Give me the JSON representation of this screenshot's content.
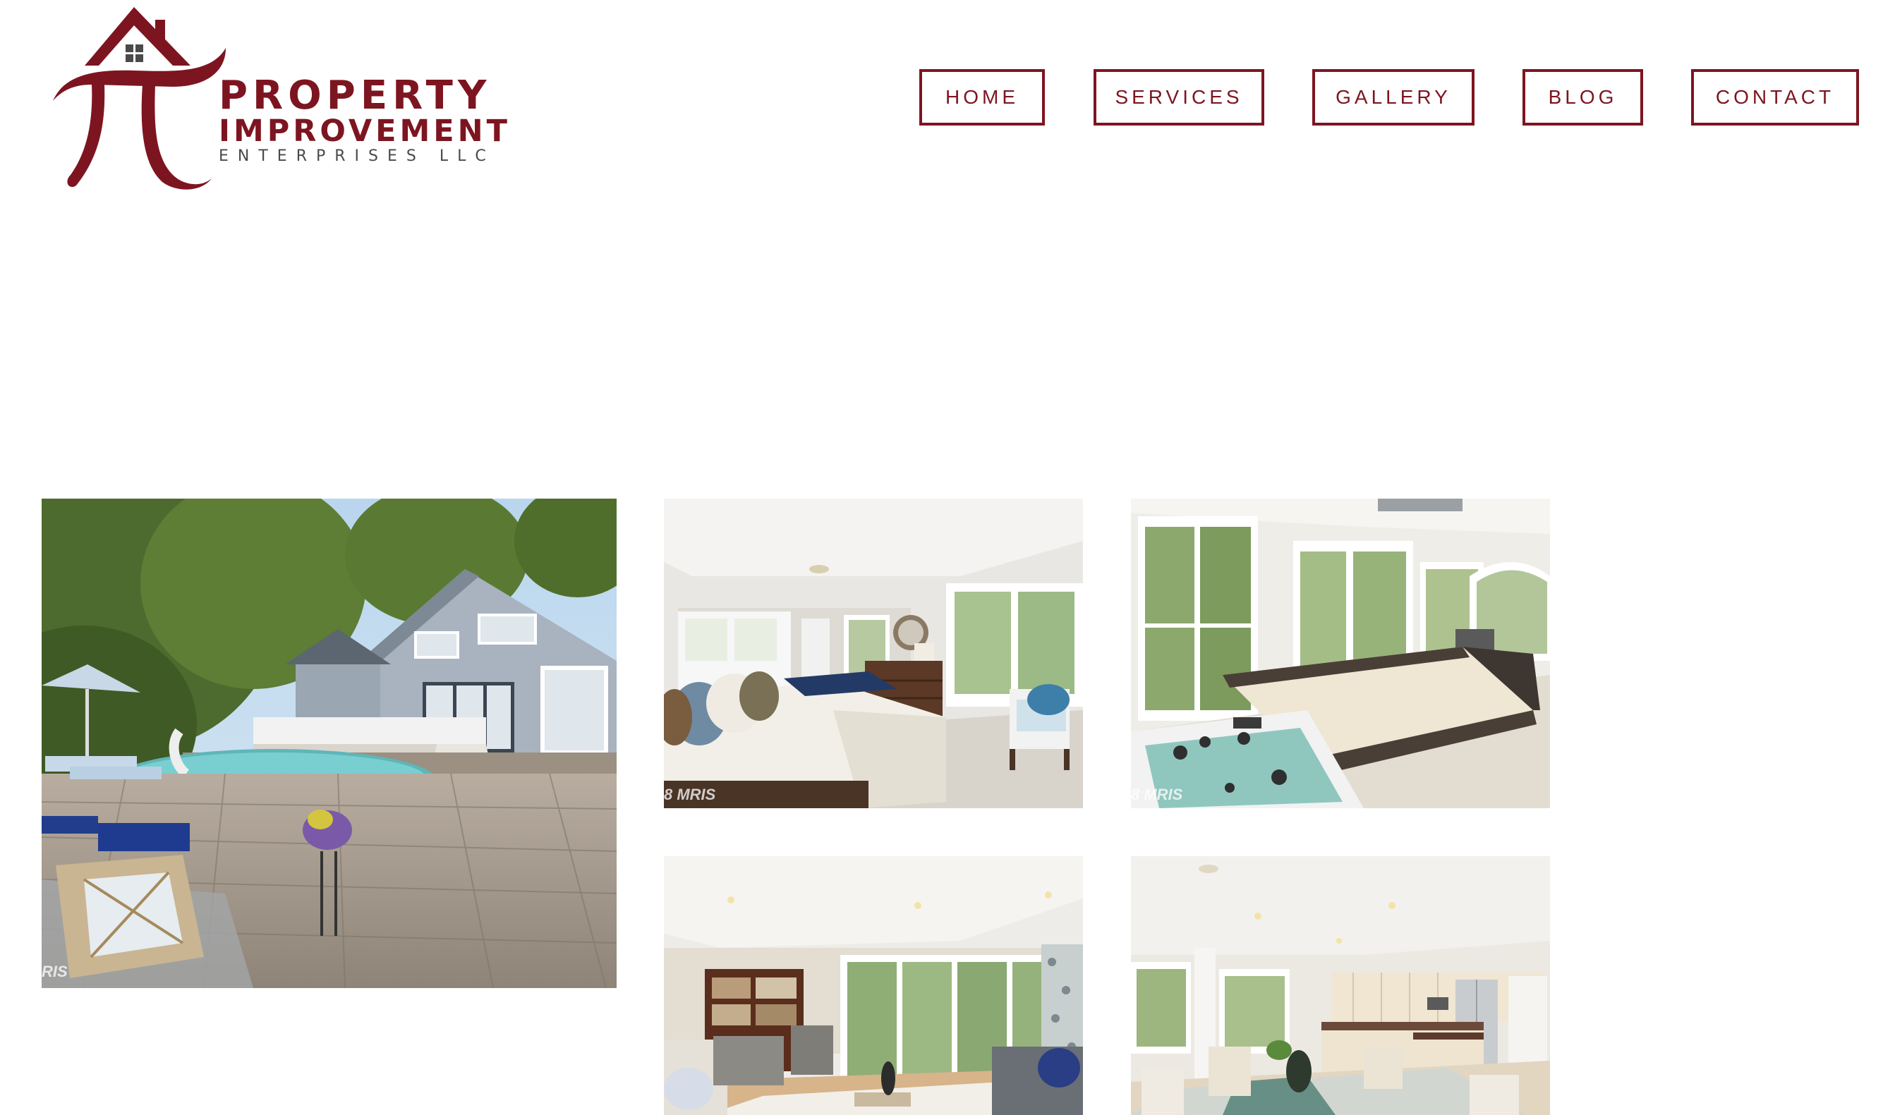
{
  "colors": {
    "brand": "#7d1520",
    "background": "#ffffff",
    "tagline_gray": "#4a4a4a"
  },
  "logo": {
    "line1": "PROPERTY",
    "line2": "IMPROVEMENT",
    "line3": "ENTERPRISES LLC",
    "icon": "pi-house-logo-icon"
  },
  "nav": {
    "home": "HOME",
    "services": "SERVICES",
    "gallery": "GALLERY",
    "blog": "BLOG",
    "contact": "CONTACT"
  },
  "gallery": {
    "watermark_backyard": "RIS",
    "watermark_bedroom": "8 MRIS",
    "watermark_hottub": "8 MRIS"
  }
}
